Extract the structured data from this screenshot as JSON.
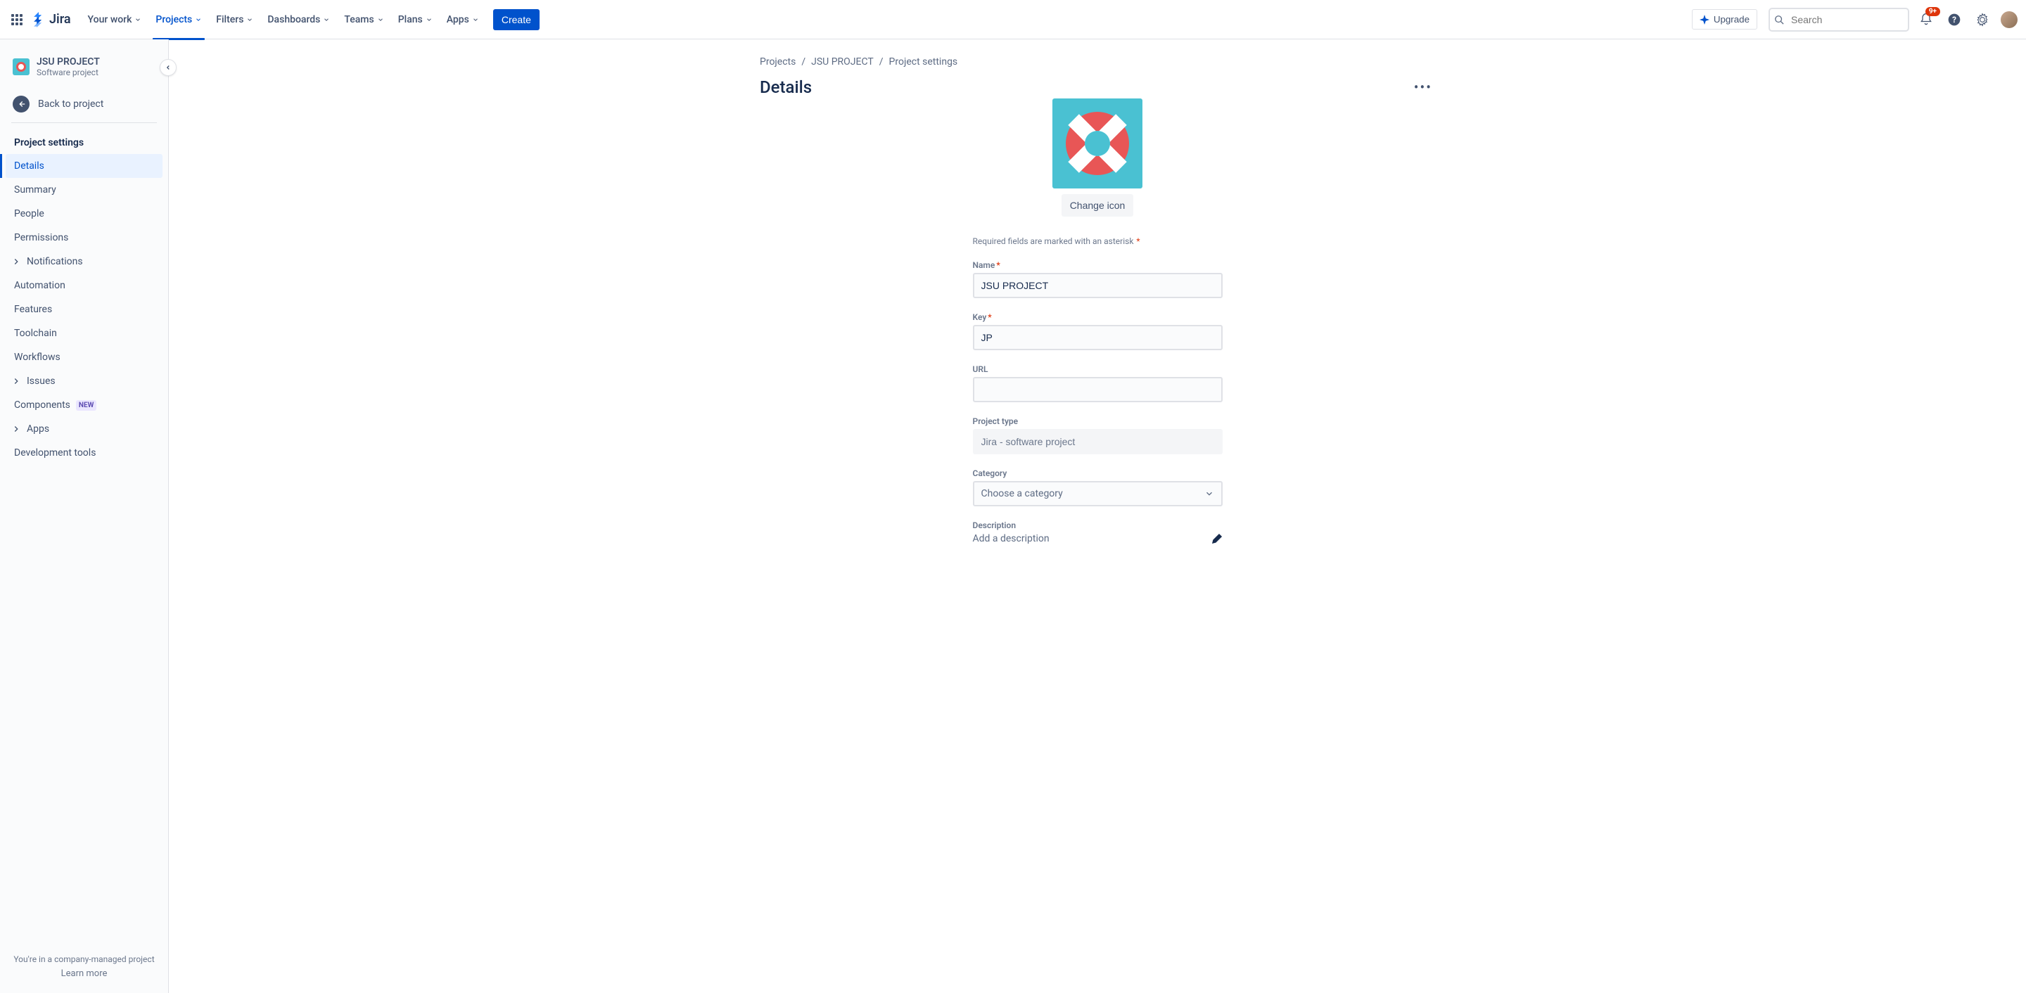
{
  "topnav": {
    "logo": "Jira",
    "items": [
      "Your work",
      "Projects",
      "Filters",
      "Dashboards",
      "Teams",
      "Plans",
      "Apps"
    ],
    "active_index": 1,
    "create": "Create",
    "upgrade": "Upgrade",
    "search_placeholder": "Search",
    "notification_badge": "9+"
  },
  "sidebar": {
    "project_name": "JSU PROJECT",
    "project_type": "Software project",
    "back": "Back to project",
    "section_title": "Project settings",
    "items": [
      {
        "label": "Details",
        "selected": true
      },
      {
        "label": "Summary"
      },
      {
        "label": "People"
      },
      {
        "label": "Permissions"
      },
      {
        "label": "Notifications",
        "expandable": true
      },
      {
        "label": "Automation"
      },
      {
        "label": "Features"
      },
      {
        "label": "Toolchain"
      },
      {
        "label": "Workflows"
      },
      {
        "label": "Issues",
        "expandable": true
      },
      {
        "label": "Components",
        "badge": "NEW"
      },
      {
        "label": "Apps",
        "expandable": true
      },
      {
        "label": "Development tools"
      }
    ],
    "footer_text": "You're in a company-managed project",
    "footer_link": "Learn more"
  },
  "breadcrumb": [
    "Projects",
    "JSU PROJECT",
    "Project settings"
  ],
  "page_title": "Details",
  "change_icon": "Change icon",
  "required_note": "Required fields are marked with an asterisk",
  "fields": {
    "name": {
      "label": "Name",
      "value": "JSU PROJECT",
      "required": true
    },
    "key": {
      "label": "Key",
      "value": "JP",
      "required": true
    },
    "url": {
      "label": "URL",
      "value": ""
    },
    "project_type": {
      "label": "Project type",
      "value": "Jira - software project"
    },
    "category": {
      "label": "Category",
      "placeholder": "Choose a category"
    },
    "description": {
      "label": "Description",
      "placeholder": "Add a description"
    }
  }
}
